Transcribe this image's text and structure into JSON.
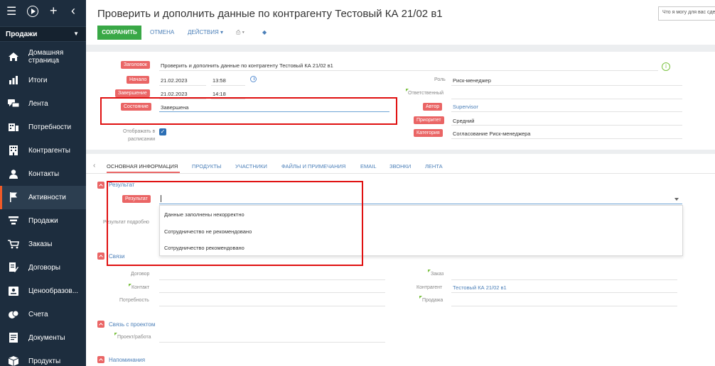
{
  "sidebar": {
    "section_label": "Продажи",
    "items": [
      {
        "icon": "home-icon",
        "label_line1": "Домашняя",
        "label_line2": "страница"
      },
      {
        "icon": "bar-chart-icon",
        "label": "Итоги"
      },
      {
        "icon": "chat-bubbles-icon",
        "label": "Лента"
      },
      {
        "icon": "needs-icon",
        "label": "Потребности"
      },
      {
        "icon": "building-icon",
        "label": "Контрагенты"
      },
      {
        "icon": "person-icon",
        "label": "Контакты"
      },
      {
        "icon": "flag-icon",
        "label": "Активности"
      },
      {
        "icon": "funnel-icon",
        "label": "Продажи"
      },
      {
        "icon": "cart-icon",
        "label": "Заказы"
      },
      {
        "icon": "contract-icon",
        "label": "Договоры"
      },
      {
        "icon": "price-icon",
        "label": "Ценообразов..."
      },
      {
        "icon": "invoice-icon",
        "label": "Счета"
      },
      {
        "icon": "document-icon",
        "label": "Документы"
      },
      {
        "icon": "box-icon",
        "label": "Продукты"
      }
    ]
  },
  "header": {
    "title": "Проверить и дополнить данные по контрагенту Тестовый КА 21/02 в1",
    "search_placeholder": "Что я могу для вас сделать?"
  },
  "toolbar": {
    "save_label": "СОХРАНИТЬ",
    "cancel_label": "ОТМЕНА",
    "actions_label": "ДЕЙСТВИЯ ▾",
    "print_label": "⎙ ▾",
    "tag_label": "◆"
  },
  "form": {
    "subject_label": "Заголовок",
    "subject_value": "Проверить и дополнить данные по контрагенту Тестовый КА 21/02 в1",
    "start_label": "Начало",
    "start_date": "21.02.2023",
    "start_time": "13:58",
    "end_label": "Завершение",
    "end_date": "21.02.2023",
    "end_time": "14:18",
    "status_label": "Состояние",
    "status_value": "Завершена",
    "show_in_schedule_label_1": "Отображать в",
    "show_in_schedule_label_2": "расписании",
    "show_in_schedule_checked": true,
    "role_label": "Роль",
    "role_value": "Риск-менеджер",
    "responsible_label": "Ответственный",
    "responsible_value": "",
    "author_label": "Автор",
    "author_value": "Supervisor",
    "priority_label": "Приоритет",
    "priority_value": "Средний",
    "category_label": "Категория",
    "category_value": "Согласование Риск-менеджера"
  },
  "tabs": [
    {
      "label": "ОСНОВНАЯ ИНФОРМАЦИЯ",
      "active": true
    },
    {
      "label": "ПРОДУКТЫ"
    },
    {
      "label": "УЧАСТНИКИ"
    },
    {
      "label": "ФАЙЛЫ И ПРИМЕЧАНИЯ"
    },
    {
      "label": "EMAIL"
    },
    {
      "label": "ЗВОНКИ"
    },
    {
      "label": "ЛЕНТА"
    }
  ],
  "result_group": {
    "title": "Результат",
    "result_label": "Результат",
    "result_value": "",
    "result_detail_label": "Результат подробно",
    "options": [
      "Данные заполнены некорректно",
      "Сотрудничество не рекомендовано",
      "Сотрудничество рекомендовано"
    ]
  },
  "links_group": {
    "title": "Связи",
    "contract_label": "Договор",
    "contact_label": "Контакт",
    "need_label": "Потребность",
    "order_label": "Заказ",
    "account_label": "Контрагент",
    "account_value": "Тестовый КА 21/02 в1",
    "sale_label": "Продажа"
  },
  "project_group": {
    "title": "Связь с проектом",
    "project_label": "Проект/работа"
  },
  "reminders_group": {
    "title": "Напоминания"
  },
  "colors": {
    "sidebar_bg": "#1d2d3e",
    "accent": "#f05a28",
    "save_green": "#39a846",
    "label_red": "#ea6565",
    "link_blue": "#4b7fb8",
    "annotation_red": "#e01010"
  }
}
